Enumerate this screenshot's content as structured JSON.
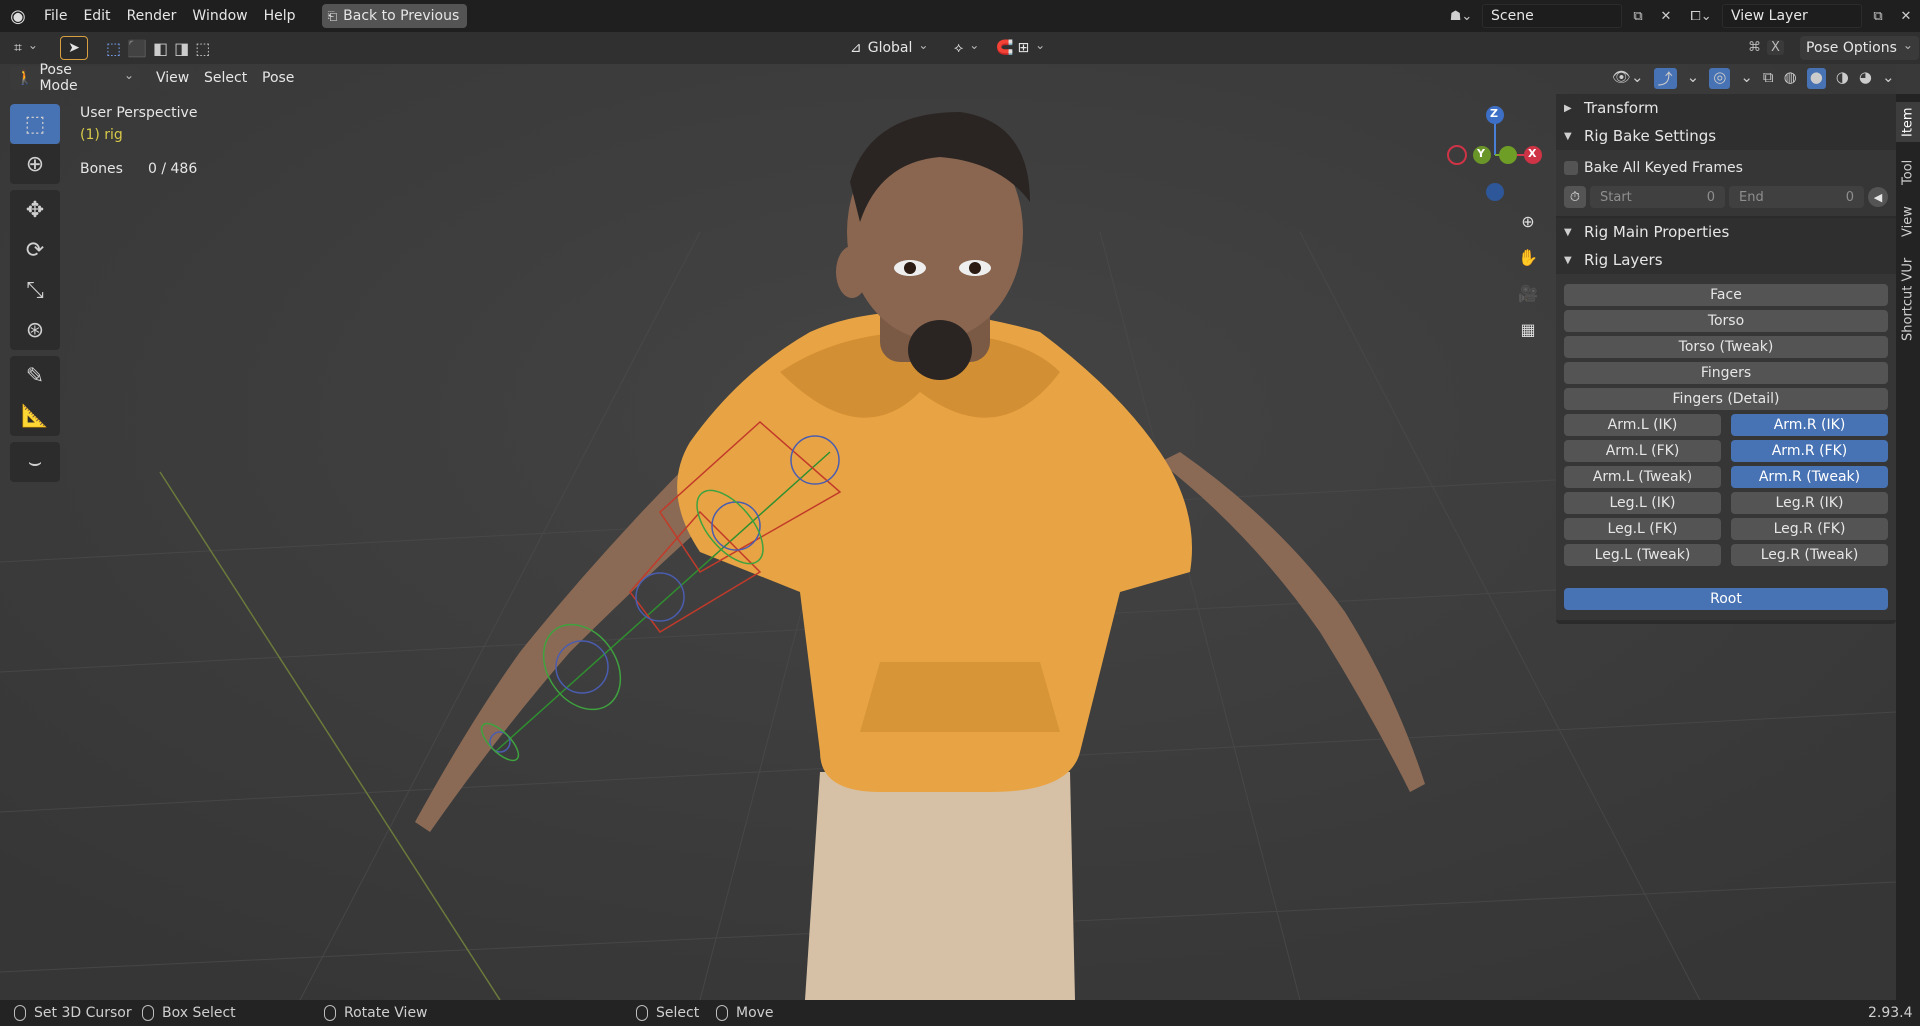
{
  "menu": [
    "File",
    "Edit",
    "Render",
    "Window",
    "Help"
  ],
  "back_to_previous": "Back to Previous",
  "scene": "Scene",
  "view_layer": "View Layer",
  "transform_orientation": "Global",
  "pose_options": "Pose Options",
  "mode": "Pose Mode",
  "header_menus": [
    "View",
    "Select",
    "Pose"
  ],
  "overlay": {
    "perspective": "User Perspective",
    "object": "(1) rig",
    "bones_label": "Bones",
    "bones_value": "0 / 486"
  },
  "panels": {
    "transform": "Transform",
    "rig_bake": "Rig Bake Settings",
    "bake_all": "Bake All Keyed Frames",
    "start_label": "Start",
    "start_value": "0",
    "end_label": "End",
    "end_value": "0",
    "rig_main": "Rig Main Properties",
    "rig_layers": "Rig Layers"
  },
  "rig_layers": {
    "single": [
      "Face",
      "Torso",
      "Torso (Tweak)",
      "Fingers",
      "Fingers (Detail)"
    ],
    "pairs": [
      {
        "left": "Arm.L (IK)",
        "right": "Arm.R (IK)",
        "right_selected": true
      },
      {
        "left": "Arm.L (FK)",
        "right": "Arm.R (FK)",
        "right_selected": true
      },
      {
        "left": "Arm.L (Tweak)",
        "right": "Arm.R (Tweak)",
        "right_selected": true
      },
      {
        "left": "Leg.L (IK)",
        "right": "Leg.R (IK)",
        "right_selected": false
      },
      {
        "left": "Leg.L (FK)",
        "right": "Leg.R (FK)",
        "right_selected": false
      },
      {
        "left": "Leg.L (Tweak)",
        "right": "Leg.R (Tweak)",
        "right_selected": false
      }
    ],
    "root": "Root"
  },
  "side_tabs": [
    "Item",
    "Tool",
    "View",
    "Shortcut VUr"
  ],
  "gizmo": {
    "z": "Z",
    "y": "Y",
    "x": "X"
  },
  "status": {
    "set_cursor": "Set 3D Cursor",
    "box_select": "Box Select",
    "rotate_view": "Rotate View",
    "select": "Select",
    "move": "Move",
    "version": "2.93.4"
  },
  "colors": {
    "accent": "#4772b3",
    "yellow": "#d8c94a",
    "hoodie": "#e8a444"
  }
}
